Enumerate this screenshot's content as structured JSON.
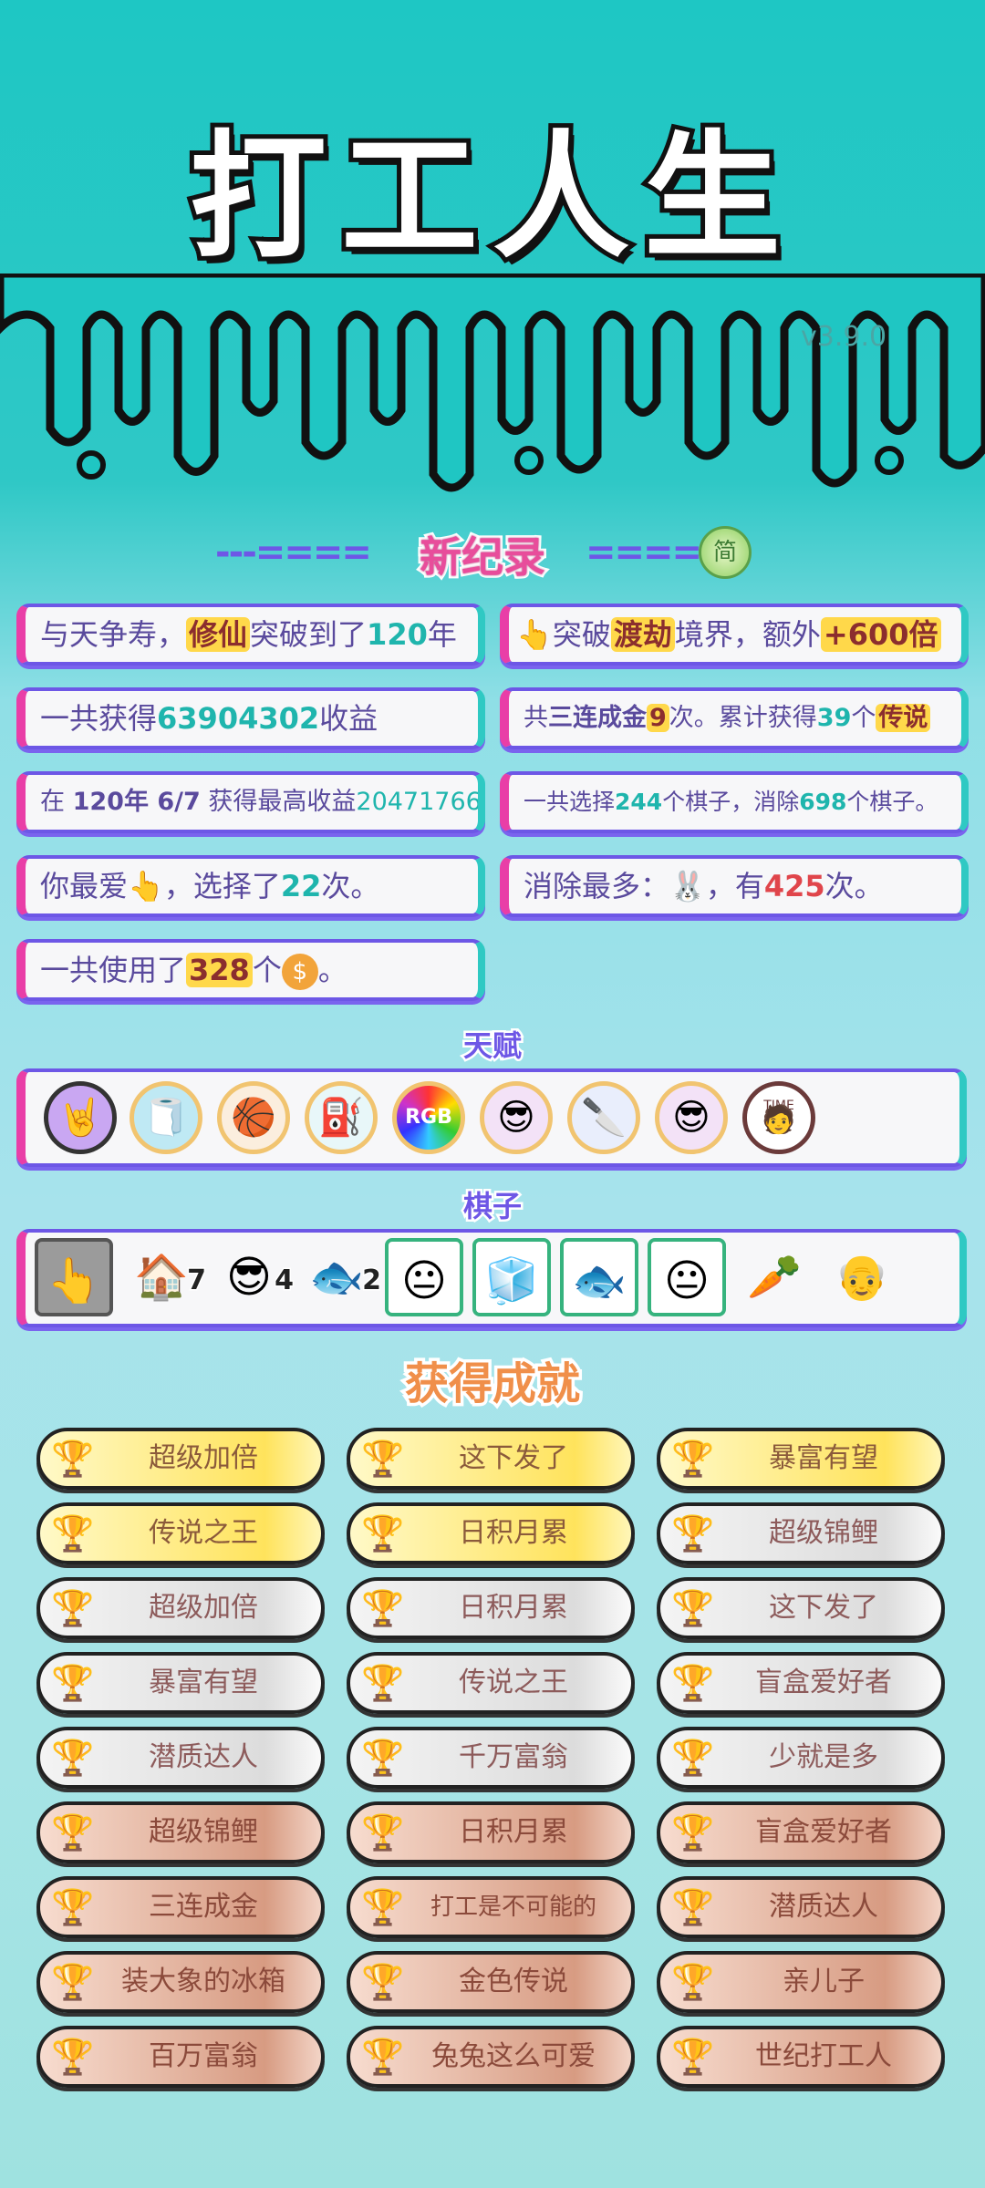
{
  "app": {
    "title": "打工人生",
    "version": "v3.9.0"
  },
  "records_header": {
    "label": "新纪录",
    "dashes_left": "---====",
    "dashes_right": "====",
    "toggle_label": "简"
  },
  "records": [
    {
      "id": "r1",
      "parts": [
        "与天争寿，",
        "修仙",
        "突破到了",
        "120",
        "年"
      ]
    },
    {
      "id": "r2",
      "parts": [
        "突破",
        "渡劫",
        "境界，额外",
        "+600倍"
      ]
    },
    {
      "id": "r3",
      "parts": [
        "一共获得",
        "63904302",
        "收益"
      ]
    },
    {
      "id": "r4",
      "parts": [
        "共",
        "三连成金",
        "9",
        "次。累计获得",
        "39",
        "个",
        "传说"
      ]
    },
    {
      "id": "r5",
      "parts": [
        "在 ",
        "120年 6/7",
        " 获得最高收益",
        "20471766"
      ]
    },
    {
      "id": "r6",
      "parts": [
        "一共选择",
        "244",
        "个棋子，消除",
        "698",
        "个棋子。"
      ]
    },
    {
      "id": "r7",
      "parts": [
        "你最爱",
        "，选择了",
        "22",
        "次。"
      ]
    },
    {
      "id": "r8",
      "parts": [
        "消除最多：",
        "，有",
        "425",
        "次。"
      ]
    },
    {
      "id": "r9",
      "parts": [
        "一共使用了",
        "328",
        "个",
        "。"
      ]
    }
  ],
  "talents_label": "天赋",
  "talents": [
    "rock-hand-icon",
    "tissue-box-icon",
    "basketball-icon",
    "pump-icon",
    "rgb-icon",
    "sunglasses-cat-icon",
    "cleaver-icon",
    "sunglasses-cat-icon",
    "time-magazine-icon"
  ],
  "talent_rgb_text": "RGB",
  "talent_time_text": "TIME",
  "pieces_label": "棋子",
  "pieces": [
    {
      "icon": "pointing-hand-icon",
      "glyph": "👆",
      "count": "",
      "style": "sel"
    },
    {
      "icon": "rabbit-house-icon",
      "glyph": "🏠",
      "count": "7",
      "style": ""
    },
    {
      "icon": "green-cap-guy-icon",
      "glyph": "😎",
      "count": "4",
      "style": ""
    },
    {
      "icon": "koi-fish-icon",
      "glyph": "🐟",
      "count": "2",
      "style": ""
    },
    {
      "icon": "worker-face-icon",
      "glyph": "😐",
      "count": "",
      "style": "box"
    },
    {
      "icon": "fridge-icon",
      "glyph": "🧊",
      "count": "",
      "style": "box"
    },
    {
      "icon": "koi-fish-icon",
      "glyph": "🐟",
      "count": "",
      "style": "box"
    },
    {
      "icon": "worker-face-icon",
      "glyph": "😐",
      "count": "",
      "style": "box"
    },
    {
      "icon": "carrot-icon",
      "glyph": "🥕",
      "count": "",
      "style": ""
    },
    {
      "icon": "old-man-icon",
      "glyph": "👴",
      "count": "",
      "style": ""
    }
  ],
  "achievements_label": "获得成就",
  "achievements": [
    {
      "label": "超级加倍",
      "tier": "gold"
    },
    {
      "label": "这下发了",
      "tier": "gold"
    },
    {
      "label": "暴富有望",
      "tier": "gold"
    },
    {
      "label": "传说之王",
      "tier": "gold"
    },
    {
      "label": "日积月累",
      "tier": "gold"
    },
    {
      "label": "超级锦鲤",
      "tier": "silver"
    },
    {
      "label": "超级加倍",
      "tier": "silver"
    },
    {
      "label": "日积月累",
      "tier": "silver"
    },
    {
      "label": "这下发了",
      "tier": "silver"
    },
    {
      "label": "暴富有望",
      "tier": "silver"
    },
    {
      "label": "传说之王",
      "tier": "silver"
    },
    {
      "label": "盲盒爱好者",
      "tier": "silver"
    },
    {
      "label": "潜质达人",
      "tier": "silver"
    },
    {
      "label": "千万富翁",
      "tier": "silver"
    },
    {
      "label": "少就是多",
      "tier": "silver"
    },
    {
      "label": "超级锦鲤",
      "tier": "bronze"
    },
    {
      "label": "日积月累",
      "tier": "bronze"
    },
    {
      "label": "盲盒爱好者",
      "tier": "bronze"
    },
    {
      "label": "三连成金",
      "tier": "bronze"
    },
    {
      "label": "打工是不可能的",
      "tier": "bronze"
    },
    {
      "label": "潜质达人",
      "tier": "bronze"
    },
    {
      "label": "装大象的冰箱",
      "tier": "bronze"
    },
    {
      "label": "金色传说",
      "tier": "bronze"
    },
    {
      "label": "亲儿子",
      "tier": "bronze"
    },
    {
      "label": "百万富翁",
      "tier": "bronze"
    },
    {
      "label": "兔兔这么可爱",
      "tier": "bronze"
    },
    {
      "label": "世纪打工人",
      "tier": "bronze"
    }
  ]
}
